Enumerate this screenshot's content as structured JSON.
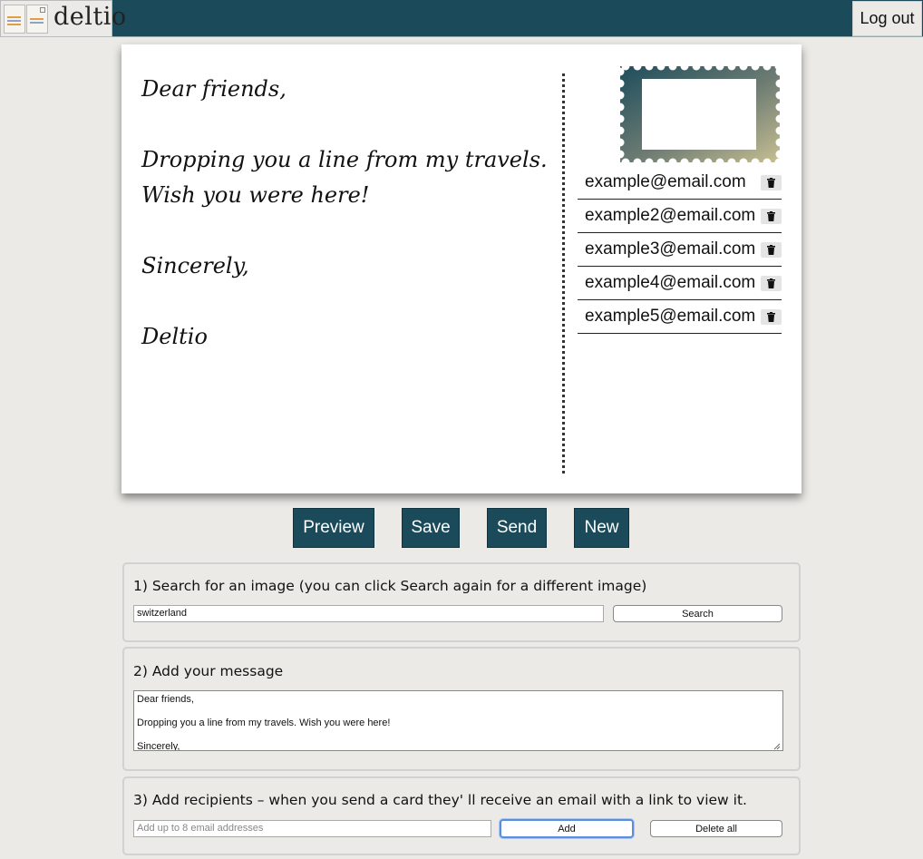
{
  "header": {
    "logo_text": "deltio",
    "logout_label": "Log out"
  },
  "postcard": {
    "message_lines": [
      "Dear friends,",
      "",
      "Dropping you a line from my travels.",
      "Wish you were here!",
      "",
      "Sincerely,",
      "",
      "Deltio"
    ],
    "recipients": [
      "example@email.com",
      "example2@email.com",
      "example3@email.com",
      "example4@email.com",
      "example5@email.com"
    ]
  },
  "actions": {
    "preview": "Preview",
    "save": "Save",
    "send": "Send",
    "new": "New"
  },
  "search_section": {
    "title": "1) Search for an image (you can click Search again for a different image)",
    "input_value": "switzerland",
    "button": "Search"
  },
  "message_section": {
    "title": "2) Add your message",
    "textarea_value": "Dear friends,\n\nDropping you a line from my travels. Wish you were here!\n\nSincerely,\n\nDeltio"
  },
  "recipients_section": {
    "title": "3) Add recipients – when you send a card they' ll receive an email with a link to view it.",
    "input_placeholder": "Add up to 8 email addresses",
    "add_button": "Add",
    "delete_all_button": "Delete all"
  },
  "colors": {
    "header_bg": "#1b4b5a",
    "page_bg": "#ebeae6",
    "button_bg": "#1b4b5a"
  },
  "icons": {
    "trash": "trash-icon",
    "stamp": "stamp-icon"
  }
}
